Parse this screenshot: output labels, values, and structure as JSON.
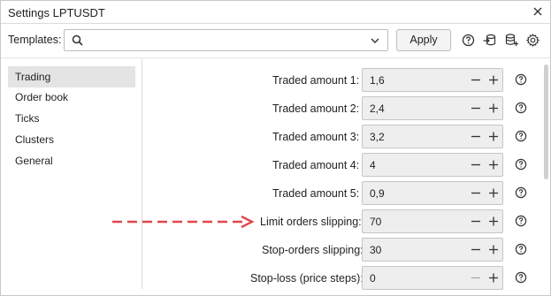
{
  "window": {
    "title": "Settings LPTUSDT"
  },
  "toolbar": {
    "templates_label": "Templates:",
    "search_value": "",
    "apply_label": "Apply"
  },
  "sidebar": {
    "items": [
      {
        "label": "Trading",
        "active": true
      },
      {
        "label": "Order book",
        "active": false
      },
      {
        "label": "Ticks",
        "active": false
      },
      {
        "label": "Clusters",
        "active": false
      },
      {
        "label": "General",
        "active": false
      }
    ]
  },
  "settings": [
    {
      "label": "Traded amount  1:",
      "value": "1,6"
    },
    {
      "label": "Traded amount  2:",
      "value": "2,4"
    },
    {
      "label": "Traded amount  3:",
      "value": "3,2"
    },
    {
      "label": "Traded amount  4:",
      "value": "4"
    },
    {
      "label": "Traded amount  5:",
      "value": "0,9"
    },
    {
      "label": "Limit orders slipping:",
      "value": "70"
    },
    {
      "label": "Stop-orders slipping:",
      "value": "30"
    },
    {
      "label": "Stop-loss (price steps):",
      "value": "0"
    }
  ],
  "colors": {
    "accent_arrow": "#e0474c",
    "field_bg": "#eeeeee",
    "active_item_bg": "#e4e4e4"
  }
}
